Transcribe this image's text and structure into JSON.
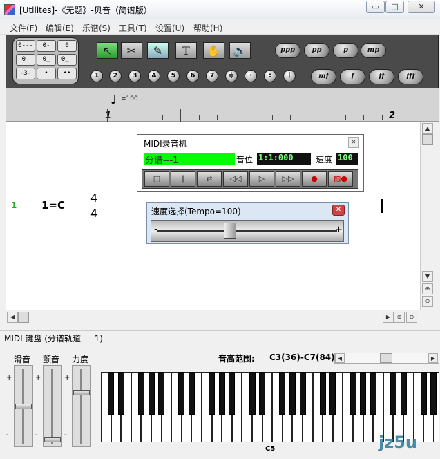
{
  "window": {
    "title": "[Utilites]-《无题》-贝音（简谱版）",
    "min": "▭",
    "max": "□",
    "close": "✕"
  },
  "menu": [
    "文件(F)",
    "编辑(E)",
    "乐谱(S)",
    "工具(T)",
    "设置(U)",
    "帮助(H)"
  ],
  "durations": [
    "0---",
    "0-",
    "0",
    "0̲",
    "0̳",
    "0̳̲",
    "-3-",
    "•",
    "••"
  ],
  "tools": [
    {
      "icon": "pointer-arrow-icon",
      "glyph": "↖"
    },
    {
      "icon": "scissors-icon",
      "glyph": "✂"
    },
    {
      "icon": "note-pen-icon",
      "glyph": "✎"
    },
    {
      "icon": "text-T-icon",
      "glyph": "T"
    },
    {
      "icon": "eraser-hand-icon",
      "glyph": "✋"
    },
    {
      "icon": "speaker-icon",
      "glyph": "🔈"
    }
  ],
  "dynamics_top": [
    "ppp",
    "pp",
    "p",
    "mp"
  ],
  "dynamics_bottom": [
    "mf",
    "f",
    "ff",
    "fff"
  ],
  "notes_numbers": [
    "1",
    "2",
    "3",
    "4",
    "5",
    "6",
    "7",
    "≑",
    "·",
    ":",
    "⋮"
  ],
  "ruler": {
    "tempo": "=100",
    "m1": "1",
    "m2": "2"
  },
  "staff": {
    "track_num": "1",
    "key": "1=C",
    "time_top": "4",
    "time_bottom": "4"
  },
  "midi_recorder": {
    "title": "MIDI录音机",
    "close": "✕",
    "track": "分谱---1",
    "position_label": "音位",
    "position": "1:1:000",
    "speed_label": "速度",
    "speed": "100",
    "buttons": [
      "□",
      "∥",
      "⇄",
      "◁◁",
      "▷",
      "▷▷",
      "●",
      "▨●"
    ]
  },
  "tempo_dialog": {
    "title": "速度选择(Tempo=100)",
    "close": "✕",
    "minus": "-",
    "plus": "+",
    "value_fraction": 0.39
  },
  "keyboard": {
    "title": "MIDI 键盘 (分谱轨道 — 1)",
    "slide_label": "滑音",
    "vibrato_label": "颤音",
    "velocity_label": "力度",
    "plus": "+",
    "minus": "-",
    "range_label": "音高范围:",
    "range": "C3(36)-C7(84)",
    "c5": "C5"
  },
  "watermark": "jz5u"
}
